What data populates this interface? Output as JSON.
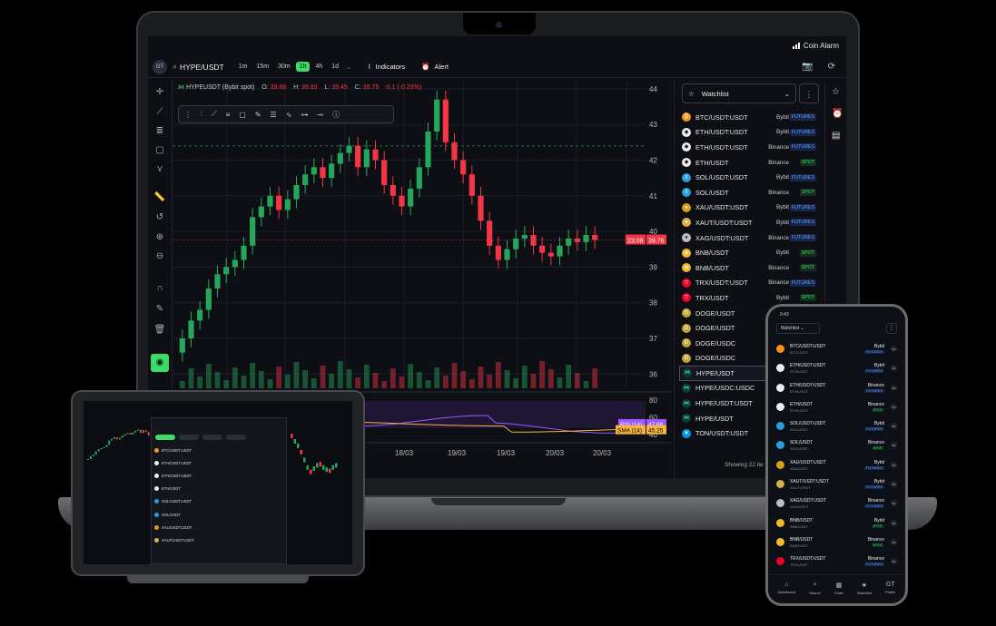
{
  "app": {
    "brand": "Coin Alarm"
  },
  "toolbar": {
    "avatar": "GT",
    "symbol": "HYPE/USDT",
    "intervals": [
      "1m",
      "15m",
      "30m",
      "1h",
      "4h",
      "1d"
    ],
    "active_interval": "1h",
    "indicators_label": "Indicators",
    "alert_label": "Alert"
  },
  "chart": {
    "symbol_label": "HYPEUSDT (Bybit spot)",
    "open_label": "O:",
    "open": "39.88",
    "high_label": "H:",
    "high": "39.89",
    "low_label": "L:",
    "low": "39.45",
    "close_label": "C:",
    "close": "39.76",
    "change": "-0.1 (-0.23%)",
    "countdown_tag": "23:08",
    "price_tag": "39.76",
    "rsi_label": "RSI (14)",
    "rsi_value": "47.68",
    "sma_label": "SMA (14)",
    "sma_value": "45.25",
    "price_axis_ticks": [
      "44",
      "43",
      "42",
      "41",
      "40",
      "39",
      "38",
      "37",
      "36"
    ],
    "rsi_axis_ticks": [
      "80",
      "60",
      "40"
    ],
    "time_axis_ticks": [
      "18/03",
      "18/03",
      "19/03",
      "19/03",
      "20/03",
      "20/03"
    ],
    "colors": {
      "up": "#26a65b",
      "down": "#f23645",
      "rsi": "#9b59ff",
      "sma": "#f5b53a"
    }
  },
  "chart_data": {
    "type": "line",
    "title": "",
    "xlabel": "",
    "ylabel": "",
    "ylim": [
      35.6,
      44.2
    ],
    "series": [
      {
        "values": [
          37.0,
          37.5,
          37.8,
          38.4,
          38.8,
          39.0,
          39.2,
          39.6,
          40.4,
          40.7,
          41.0,
          40.6,
          40.9,
          41.3,
          41.6,
          41.8,
          41.5,
          41.9,
          42.2,
          42.4,
          41.8,
          42.3,
          42.0,
          41.3,
          41.0,
          40.7,
          41.2,
          41.8,
          42.8,
          43.7,
          42.5,
          42.0,
          41.6,
          41.0,
          40.3,
          39.6,
          39.2,
          39.5,
          39.8,
          39.9,
          39.6,
          39.4,
          39.3,
          39.6,
          39.8,
          39.7,
          39.9,
          39.76
        ]
      }
    ]
  },
  "drawing_tools": [
    "grip",
    "candles",
    "line",
    "hlines",
    "rect",
    "brush",
    "fib",
    "pattern",
    "path",
    "measure",
    "settings"
  ],
  "left_tools": [
    "crosshair",
    "trendline",
    "fib-retracement",
    "rectangle",
    "patterns",
    "ruler",
    "undo",
    "zoom-in",
    "zoom-out",
    "magnet",
    "pencil-lock",
    "trash",
    "visibility"
  ],
  "watchlist": {
    "title": "Watchlist",
    "showing": "Showing 22 ite",
    "items": [
      {
        "name": "BTC/USDT:USDT",
        "exchange": "Bybit",
        "type": "FUTURES",
        "color": "#f7931a",
        "glyph": "₿"
      },
      {
        "name": "ETH/USDT:USDT",
        "exchange": "Bybit",
        "type": "FUTURES",
        "color": "#ececec",
        "glyph": "◆"
      },
      {
        "name": "ETH/USDT:USDT",
        "exchange": "Binance",
        "type": "FUTURES",
        "color": "#ececec",
        "glyph": "◆"
      },
      {
        "name": "ETH/USDT",
        "exchange": "Binance",
        "type": "SPOT",
        "color": "#ececec",
        "glyph": "◆"
      },
      {
        "name": "SOL/USDT:USDT",
        "exchange": "Bybit",
        "type": "FUTURES",
        "color": "#2d9cdb",
        "glyph": "≡"
      },
      {
        "name": "SOL/USDT",
        "exchange": "Binance",
        "type": "SPOT",
        "color": "#2d9cdb",
        "glyph": "≡"
      },
      {
        "name": "XAU/USDT:USDT",
        "exchange": "Bybit",
        "type": "FUTURES",
        "color": "#d4a017",
        "glyph": "●"
      },
      {
        "name": "XAUT/USDT:USDT",
        "exchange": "Bybit",
        "type": "FUTURES",
        "color": "#d9b04a",
        "glyph": "●"
      },
      {
        "name": "XAG/USDT:USDT",
        "exchange": "Binance",
        "type": "FUTURES",
        "color": "#bfbfbf",
        "glyph": "●"
      },
      {
        "name": "BNB/USDT",
        "exchange": "Bybit",
        "type": "SPOT",
        "color": "#f3ba2f",
        "glyph": "◈"
      },
      {
        "name": "BNB/USDT",
        "exchange": "Binance",
        "type": "SPOT",
        "color": "#f3ba2f",
        "glyph": "◈"
      },
      {
        "name": "TRX/USDT:USDT",
        "exchange": "Binance",
        "type": "FUTURES",
        "color": "#ef0027",
        "glyph": "▽"
      },
      {
        "name": "TRX/USDT",
        "exchange": "Bybit",
        "type": "SPOT",
        "color": "#ef0027",
        "glyph": "▽"
      },
      {
        "name": "DOGE/USDT",
        "exchange": "",
        "type": "",
        "color": "#c2a633",
        "glyph": "Ð"
      },
      {
        "name": "DOGE/USDT",
        "exchange": "",
        "type": "",
        "color": "#c2a633",
        "glyph": "Ð"
      },
      {
        "name": "DOGE/USDC",
        "exchange": "",
        "type": "",
        "color": "#c2a633",
        "glyph": "Ð"
      },
      {
        "name": "DOGE/USDC",
        "exchange": "",
        "type": "",
        "color": "#c2a633",
        "glyph": "Ð"
      },
      {
        "name": "HYPE/USDT",
        "exchange": "",
        "type": "",
        "color": "#0a3d34",
        "glyph": "⋈",
        "selected": true
      },
      {
        "name": "HYPE/USDC:USDC",
        "exchange": "",
        "type": "",
        "color": "#0a3d34",
        "glyph": "⋈"
      },
      {
        "name": "HYPE/USDT:USDT",
        "exchange": "",
        "type": "",
        "color": "#0a3d34",
        "glyph": "⋈"
      },
      {
        "name": "HYPE/USDT",
        "exchange": "",
        "type": "",
        "color": "#0a3d34",
        "glyph": "⋈"
      },
      {
        "name": "TON/USDT:USDT",
        "exchange": "",
        "type": "",
        "color": "#0098ea",
        "glyph": "▼"
      }
    ]
  },
  "phone": {
    "time": "9:43",
    "watchlist": "Watchlist",
    "items": [
      {
        "name": "BTC/USDT:USDT",
        "sub": "BTC/USDT",
        "exchange": "Bybit",
        "type": "FUTURES",
        "color": "#f7931a"
      },
      {
        "name": "ETH/USDT:USDT",
        "sub": "ETH/USDT",
        "exchange": "Bybit",
        "type": "FUTURES",
        "color": "#ececec"
      },
      {
        "name": "ETH/USDT:USDT",
        "sub": "ETH/USDT",
        "exchange": "Binance",
        "type": "FUTURES",
        "color": "#ececec"
      },
      {
        "name": "ETH/USDT",
        "sub": "ETH/USDT",
        "exchange": "Binance",
        "type": "SPOT",
        "color": "#ececec"
      },
      {
        "name": "SOL/USDT:USDT",
        "sub": "SOL/USDT",
        "exchange": "Bybit",
        "type": "FUTURES",
        "color": "#2d9cdb"
      },
      {
        "name": "SOL/USDT",
        "sub": "SOL/USDT",
        "exchange": "Binance",
        "type": "SPOT",
        "color": "#2d9cdb"
      },
      {
        "name": "XAU/USDT:USDT",
        "sub": "XAU/USDT",
        "exchange": "Bybit",
        "type": "FUTURES",
        "color": "#d4a017"
      },
      {
        "name": "XAUT/USDT:USDT",
        "sub": "XAUT/USDT",
        "exchange": "Bybit",
        "type": "FUTURES",
        "color": "#d9b04a"
      },
      {
        "name": "XAG/USDT:USDT",
        "sub": "XAG/USDT",
        "exchange": "Binance",
        "type": "FUTURES",
        "color": "#bfbfbf"
      },
      {
        "name": "BNB/USDT",
        "sub": "BNB/USDT",
        "exchange": "Bybit",
        "type": "SPOT",
        "color": "#f3ba2f"
      },
      {
        "name": "BNB/USDT",
        "sub": "BNB/USDT",
        "exchange": "Binance",
        "type": "SPOT",
        "color": "#f3ba2f"
      },
      {
        "name": "TRX/USDT:USDT",
        "sub": "TRX/USDT",
        "exchange": "Binance",
        "type": "FUTURES",
        "color": "#ef0027"
      }
    ],
    "nav": [
      "Dashboard",
      "Search",
      "Chart",
      "Watchlist",
      "Profile"
    ]
  },
  "tablet": {
    "items": [
      "BTC/USDT:USDT",
      "ETH/USDT:USDT",
      "ETH/USDT:USDT",
      "ETH/USDT",
      "SOL/USDT:USDT",
      "SOL/USDT",
      "XAU/USDT:USDT",
      "XAUT/USDT:USDT"
    ]
  }
}
